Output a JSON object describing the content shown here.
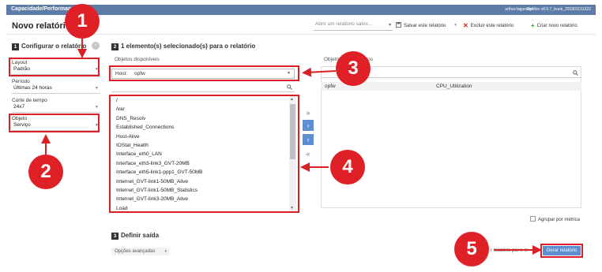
{
  "topbar": {
    "title": "Capacidade/Performance",
    "user": "arthur.fagundes",
    "version": "OpMon v8.5.7_trunk_201901101322"
  },
  "header": {
    "page_title": "Novo relatório",
    "saved_placeholder": "Abrir um relatório salvo...",
    "save_label": "Salvar este relatório",
    "delete_label": "Excluir este relatório",
    "new_label": "Criar novo relatório"
  },
  "section1": {
    "num": "1",
    "title": "Configurar o relatório"
  },
  "section2": {
    "num": "2",
    "title": "1 elemento(s) selecionado(s) para o relatório",
    "avail_label": "Objetos disponíveis",
    "selected_label": "Objetos selecionados"
  },
  "section3": {
    "num": "3",
    "title": "Definir saída"
  },
  "fields": {
    "layout_label": "Layout",
    "layout_value": "Padrão",
    "periodo_label": "Período",
    "periodo_value": "Últimas 24 horas",
    "corte_label": "Corte de tempo",
    "corte_value": "24x7",
    "objeto_label": "Objeto",
    "objeto_value": "Serviço"
  },
  "host": {
    "label": "Host:",
    "value": "opfw"
  },
  "available_items": [
    "/",
    "/var",
    "DNS_Resolv",
    "Established_Connections",
    "Host-Alive",
    "IOStat_Health",
    "Interface_eth0_LAN",
    "Interface_eth3-link3_GVT-20MB",
    "Interface_eth5-link1-ppp1_GVT-50MB",
    "Internet_GVT-link1-50MB_Alive",
    "Internet_GVT-link1-50MB_Statistics",
    "Internet_GVT-link3-20MB_Alive",
    "Load"
  ],
  "selected_row": {
    "host": "opfw",
    "service": "CPU_Utilization"
  },
  "move_buttons": {
    "add_all": "»",
    "add": "›",
    "remove": "‹",
    "remove_all": "«"
  },
  "agrupar_label": "Agrupar por métrica",
  "opcoes_label": "Opções avançadas",
  "obscured_label": "r relatório por e-m",
  "gerar_label": "Gerar relatório",
  "callouts": [
    "1",
    "2",
    "3",
    "4",
    "5"
  ],
  "colors": {
    "accent": "#5c7ba6",
    "highlight": "#d92027",
    "callout": "#e02027",
    "button": "#5c8ed1"
  }
}
